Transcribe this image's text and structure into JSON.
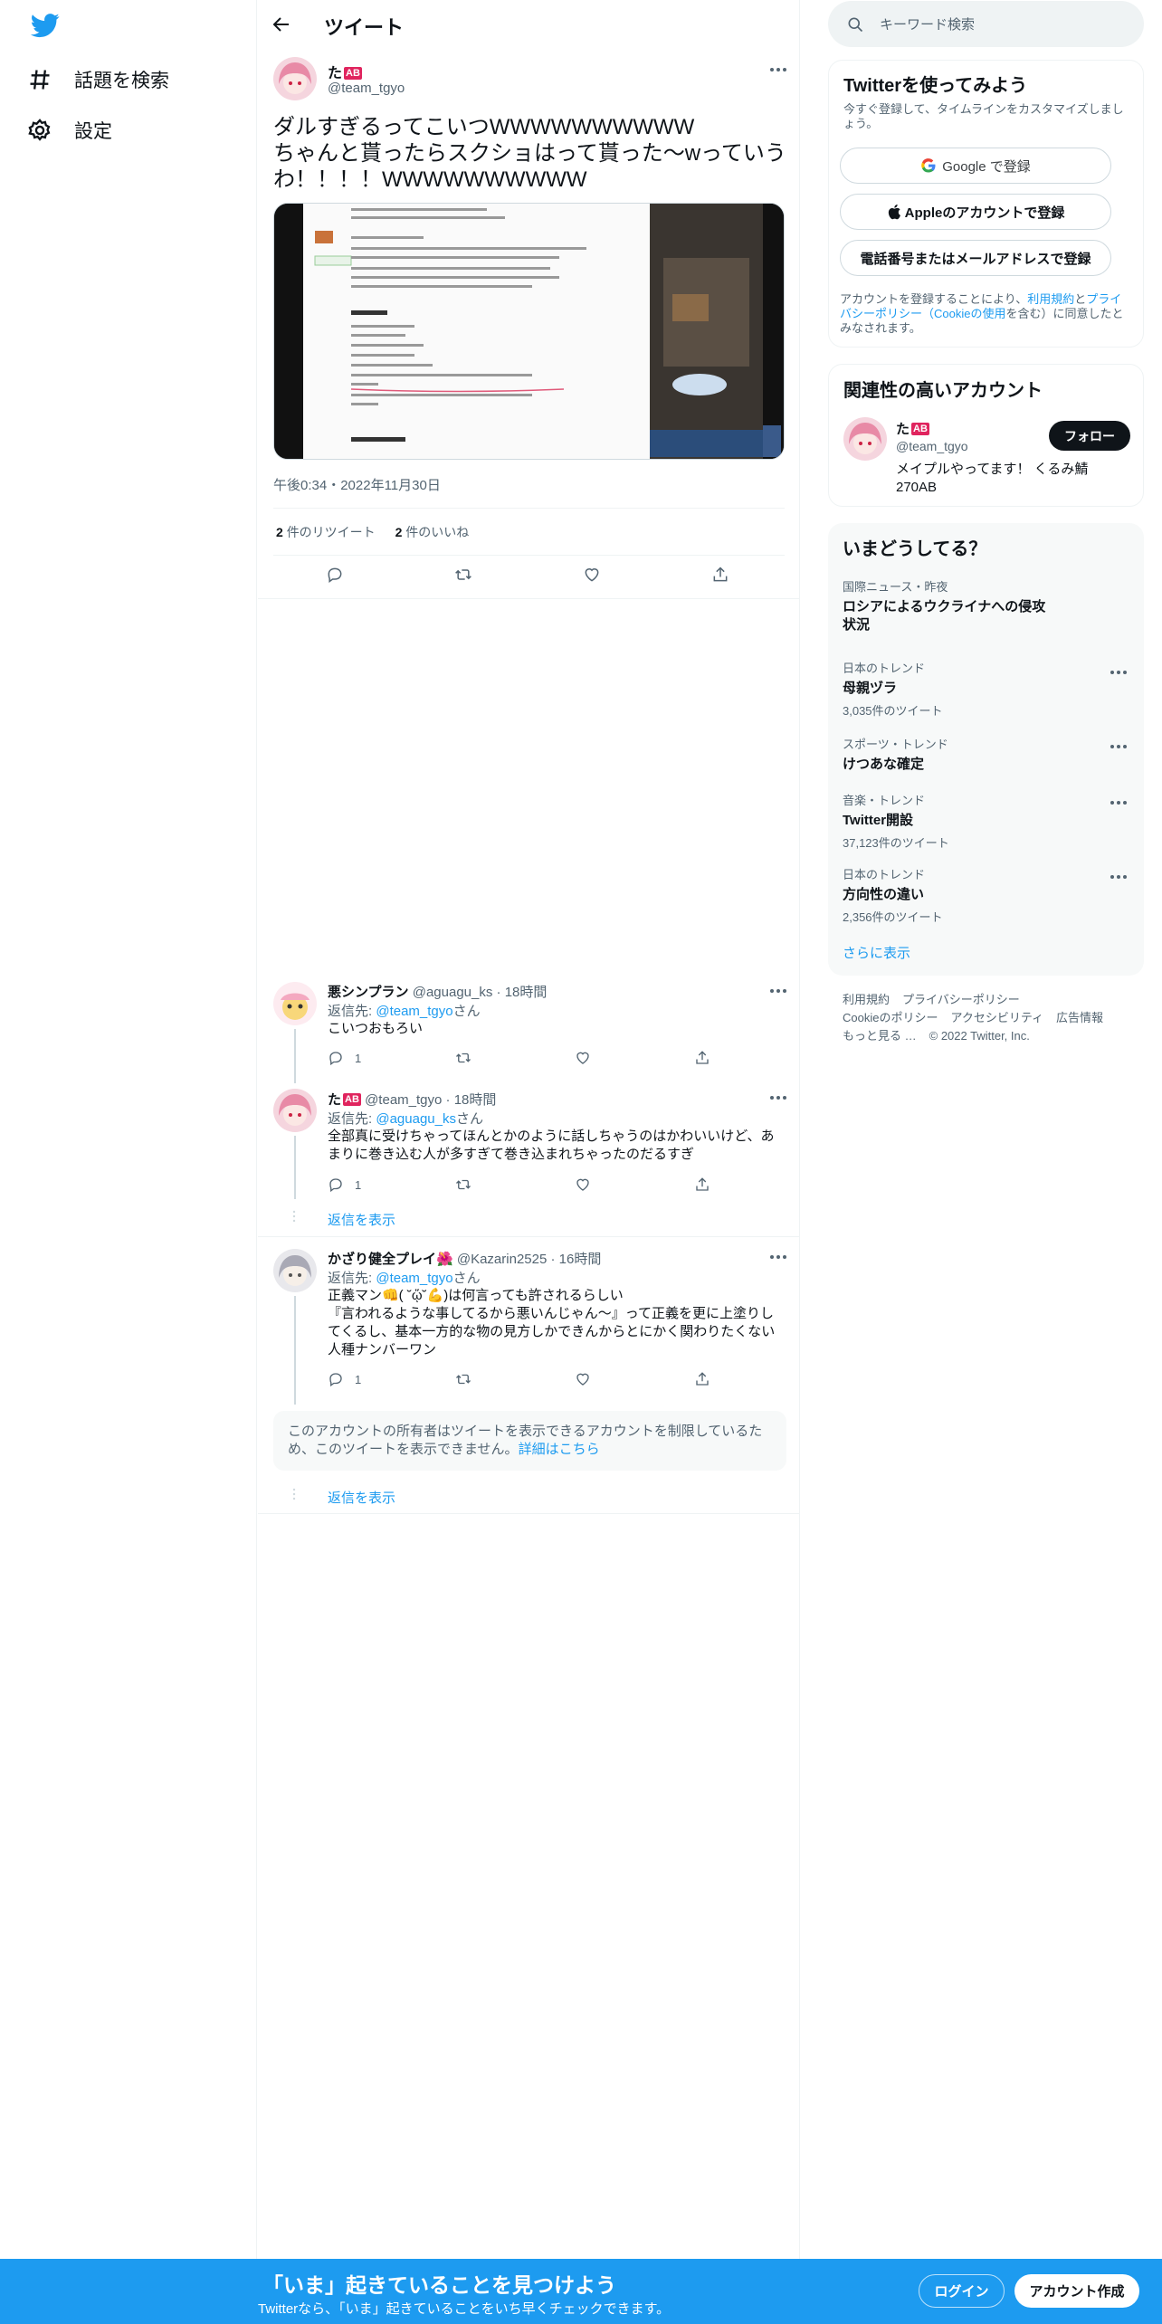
{
  "nav": {
    "explore_label": "話題を検索",
    "settings_label": "設定"
  },
  "header": {
    "title": "ツイート"
  },
  "tweet": {
    "author_name": "た",
    "author_badge": "AB",
    "author_handle": "@team_tgyo",
    "text_line1": "ダルすぎるってこいつWWWWWWWWWW",
    "text_line2": "ちゃんと貰ったらスクショはって貰った〜wっていう",
    "text_line3": "わ！！！！WWWWWWWWWW",
    "timestamp": "午後0:34・2022年11月30日",
    "retweet_count": "2",
    "retweet_label": "件のリツイート",
    "like_count": "2",
    "like_label": "件のいいね"
  },
  "replies": [
    {
      "name": "悪シンプラン",
      "handle": "@aguagu_ks",
      "time": "· 18時間",
      "reply_to_label": "返信先:",
      "reply_to": "@team_tgyo",
      "reply_to_suffix": "さん",
      "text": "こいつおもろい",
      "reply_count": "1"
    },
    {
      "name": "た",
      "badge": "AB",
      "handle": "@team_tgyo",
      "time": "· 18時間",
      "reply_to_label": "返信先:",
      "reply_to": "@aguagu_ks",
      "reply_to_suffix": "さん",
      "text_line1": "全部真に受けちゃってほんとかのように話しちゃうのはかわいいけど、あ",
      "text_line2": "まりに巻き込む人が多すぎて巻き込まれちゃったのだるすぎ",
      "reply_count": "1"
    },
    {
      "name": "かざり健全プレイ🌺",
      "handle": "@Kazarin2525",
      "time": "· 16時間",
      "reply_to_label": "返信先:",
      "reply_to": "@team_tgyo",
      "reply_to_suffix": "さん",
      "text_line1": "正義マン👊( ˘ᾥ˘💪)は何言っても許されるらしい",
      "text_line2": "『言われるような事してるから悪いんじゃん〜』って正義を更に上塗りし",
      "text_line3": "てくるし、基本一方的な物の見方しかできんからとにかく関わりたくない",
      "text_line4": "人種ナンバーワン",
      "reply_count": "1"
    }
  ],
  "show_replies_label": "返信を表示",
  "notice": {
    "text_line1": "このアカウントの所有者はツイートを表示できるアカウントを制限しているた",
    "text_line2": "め、このツイートを表示できません。",
    "link": "詳細はこちら"
  },
  "search": {
    "placeholder": "キーワード検索"
  },
  "signup_card": {
    "title": "Twitterを使ってみよう",
    "subtitle_line1": "今すぐ登録して、タイムラインをカスタマイズしまし",
    "subtitle_line2": "ょう。",
    "google_label": "Google で登録",
    "apple_label": "Appleのアカウントで登録",
    "phone_label": "電話番号またはメールアドレスで登録",
    "legal_line1_a": "アカウントを登録することにより、",
    "legal_line1_link": "利用規約",
    "legal_line1_b": "と",
    "legal_line1_link2": "プライ",
    "legal_line2_link": "バシーポリシー（Cookieの使用",
    "legal_line2_b": "を含む）に同意したと",
    "legal_line3": "みなされます。"
  },
  "related": {
    "title": "関連性の高いアカウント",
    "name": "た",
    "badge": "AB",
    "handle": "@team_tgyo",
    "follow_label": "フォロー",
    "bio_line1": "メイプルやってます！ くるみ鯖",
    "bio_line2": "270AB"
  },
  "trends": {
    "title": "いまどうしてる？",
    "items": [
      {
        "category": "国際ニュース・昨夜",
        "name_line1": "ロシアによるウクライナへの侵攻",
        "name_line2": "状況",
        "count": ""
      },
      {
        "category": "日本のトレンド",
        "name_line1": "母親ヅラ",
        "name_line2": "",
        "count": "3,035件のツイート"
      },
      {
        "category": "スポーツ・トレンド",
        "name_line1": "けつあな確定",
        "name_line2": "",
        "count": ""
      },
      {
        "category": "音楽・トレンド",
        "name_line1": "Twitter開設",
        "name_line2": "",
        "count": "37,123件のツイート"
      },
      {
        "category": "日本のトレンド",
        "name_line1": "方向性の違い",
        "name_line2": "",
        "count": "2,356件のツイート"
      }
    ],
    "show_more": "さらに表示"
  },
  "footer": {
    "terms": "利用規約",
    "privacy": "プライバシーポリシー",
    "cookie": "Cookieのポリシー",
    "accessibility": "アクセシビリティ",
    "ads": "広告情報",
    "more": "もっと見る …",
    "copyright": "© 2022 Twitter, Inc."
  },
  "bottom_bar": {
    "title": "「いま」起きていることを見つけよう",
    "subtitle": "Twitterなら、「いま」起きていることをいち早くチェックできます。",
    "login": "ログイン",
    "signup": "アカウント作成"
  }
}
